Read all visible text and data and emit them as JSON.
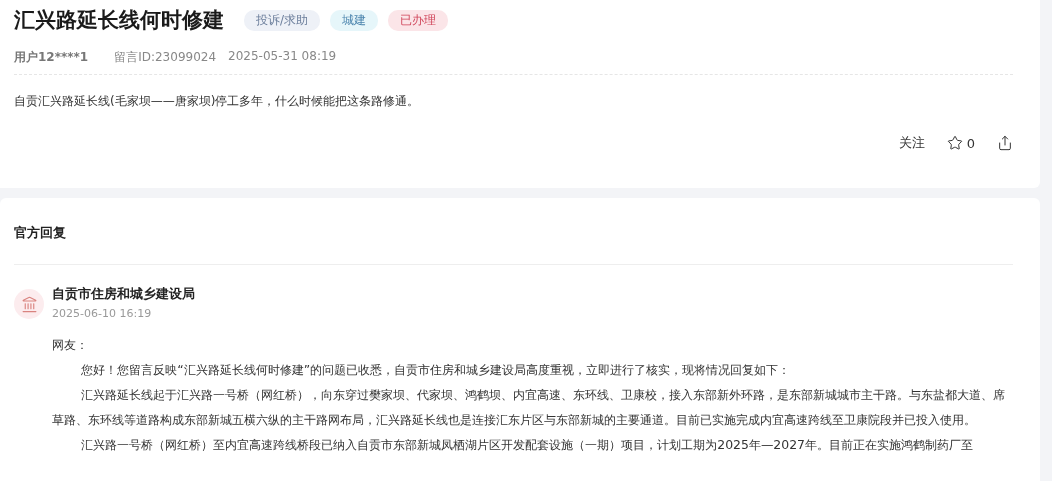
{
  "question": {
    "title": "汇兴路延长线何时修建",
    "tags": [
      {
        "label": "投诉/求助",
        "color": "#eef1f7",
        "kind": "type"
      },
      {
        "label": "城建",
        "color": "#e6f6fa",
        "kind": "category"
      },
      {
        "label": "已办理",
        "color": "#fbe5e8",
        "kind": "status"
      }
    ],
    "user": "用户12****1",
    "message_id": "留言ID:23099024",
    "time": "2025-05-31 08:19",
    "body": "自贡汇兴路延长线(毛家坝——唐家坝)停工多年，什么时候能把这条路修通。",
    "actions": {
      "follow": "关注",
      "star_count": "0"
    }
  },
  "reply": {
    "heading": "官方回复",
    "department": "自贡市住房和城乡建设局",
    "time": "2025-06-10 16:19",
    "greeting": "网友：",
    "paragraphs": [
      "您好！您留言反映“汇兴路延长线何时修建”的问题已收悉，自贡市住房和城乡建设局高度重视，立即进行了核实，现将情况回复如下：",
      "汇兴路延长线起于汇兴路一号桥（网红桥），向东穿过樊家坝、代家坝、鸿鹤坝、内宜高速、东环线、卫康校，接入东部新外环路，是东部新城城市主干路。与东盐都大道、席草路、东环线等道路构成东部新城五横六纵的主干路网布局，汇兴路延长线也是连接汇东片区与东部新城的主要通道。目前已实施完成内宜高速跨线至卫康院段并已投入使用。",
      "汇兴路一号桥（网红桥）至内宜高速跨线桥段已纳入自贡市东部新城凤栖湖片区开发配套设施（一期）项目，计划工期为2025年—2027年。目前正在实施鸿鹤制药厂至"
    ]
  }
}
